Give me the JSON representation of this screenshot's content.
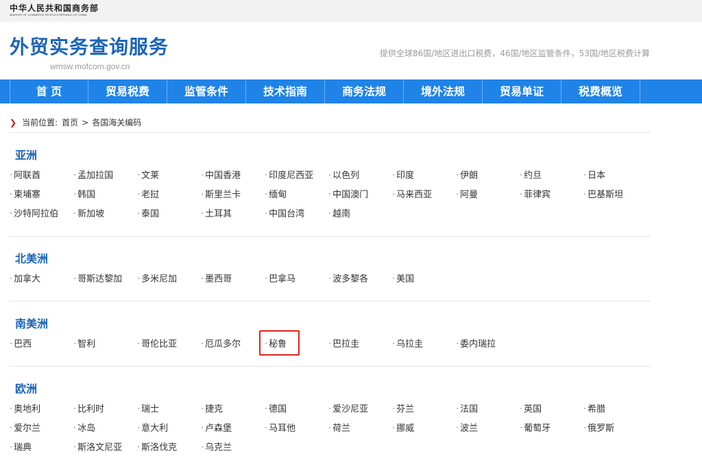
{
  "header": {
    "ministry_cn": "中华人民共和国商务部",
    "ministry_en": "MINISTRY OF COMMERCE PEOPLE'S REPUBLIC OF CHINA",
    "site_title": "外贸实务查询服务",
    "site_url": "wmsw.mofcom.gov.cn",
    "site_desc": "提供全球86国/地区进出口税费，46国/地区监管条件，53国/地区税费计算"
  },
  "nav": {
    "items": [
      "首 页",
      "贸易税费",
      "监管条件",
      "技术指南",
      "商务法规",
      "境外法规",
      "贸易单证",
      "税费概览"
    ]
  },
  "breadcrumb": {
    "label": "当前位置:",
    "home": "首页",
    "separator": ">",
    "current": "各国海关编码"
  },
  "regions": [
    {
      "title": "亚洲",
      "countries": [
        "阿联酋",
        "孟加拉国",
        "文莱",
        "中国香港",
        "印度尼西亚",
        "以色列",
        "印度",
        "伊朗",
        "约旦",
        "日本",
        "柬埔寨",
        "韩国",
        "老挝",
        "斯里兰卡",
        "缅甸",
        "中国澳门",
        "马来西亚",
        "阿曼",
        "菲律宾",
        "巴基斯坦",
        "沙特阿拉伯",
        "新加坡",
        "泰国",
        "土耳其",
        "中国台湾",
        "越南"
      ]
    },
    {
      "title": "北美洲",
      "countries": [
        "加拿大",
        "哥斯达黎加",
        "多米尼加",
        "墨西哥",
        "巴拿马",
        "波多黎各",
        "美国"
      ]
    },
    {
      "title": "南美洲",
      "countries": [
        "巴西",
        "智利",
        "哥伦比亚",
        "厄瓜多尔",
        "秘鲁",
        "巴拉圭",
        "乌拉圭",
        "委内瑞拉"
      ]
    },
    {
      "title": "欧洲",
      "countries": [
        "奥地利",
        "比利时",
        "瑞士",
        "捷克",
        "德国",
        "爱沙尼亚",
        "芬兰",
        "法国",
        "英国",
        "希腊",
        "爱尔兰",
        "冰岛",
        "意大利",
        "卢森堡",
        "马耳他",
        "荷兰",
        "挪威",
        "波兰",
        "葡萄牙",
        "俄罗斯",
        "瑞典",
        "斯洛文尼亚",
        "斯洛伐克",
        "乌克兰"
      ]
    }
  ],
  "highlighted_country": "秘鲁",
  "colors": {
    "brand_blue": "#1a64b8",
    "nav_blue": "#1f83e8",
    "highlight_red": "#e02020",
    "crumb_arrow": "#c8161d"
  }
}
